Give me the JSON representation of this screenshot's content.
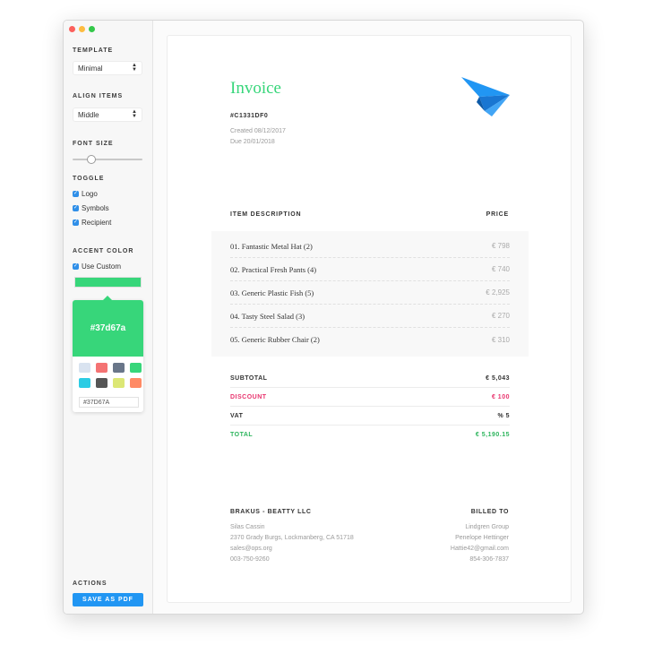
{
  "sidebar": {
    "template_label": "TEMPLATE",
    "template_value": "Minimal",
    "align_label": "ALIGN ITEMS",
    "align_value": "Middle",
    "font_size_label": "FONT SIZE",
    "toggle_label": "TOGGLE",
    "toggles": [
      "Logo",
      "Symbols",
      "Recipient"
    ],
    "accent_label": "ACCENT COLOR",
    "use_custom_label": "Use Custom",
    "accent_color": "#37d67a",
    "accent_hex_display": "#37d67a",
    "hex_input_value": "#37D67A",
    "swatches": [
      "#d9e3f0",
      "#f47373",
      "#697689",
      "#37d67a",
      "#2ccce4",
      "#555555",
      "#dce775",
      "#ff8a65"
    ],
    "actions_label": "ACTIONS",
    "save_label": "SAVE AS PDF"
  },
  "invoice": {
    "title": "Invoice",
    "id": "#C1331DF0",
    "created": "Created 08/12/2017",
    "due": "Due 20/01/2018",
    "col_description": "ITEM DESCRIPTION",
    "col_price": "PRICE",
    "items": [
      {
        "name": "01. Fantastic Metal Hat (2)",
        "price": "€ 798"
      },
      {
        "name": "02. Practical Fresh Pants (4)",
        "price": "€ 740"
      },
      {
        "name": "03. Generic Plastic Fish (5)",
        "price": "€ 2,925"
      },
      {
        "name": "04. Tasty Steel Salad (3)",
        "price": "€ 270"
      },
      {
        "name": "05. Generic Rubber Chair (2)",
        "price": "€ 310"
      }
    ],
    "totals": {
      "subtotal_label": "SUBTOTAL",
      "subtotal_value": "€ 5,043",
      "discount_label": "DISCOUNT",
      "discount_value": "€ 100",
      "vat_label": "VAT",
      "vat_value": "% 5",
      "total_label": "TOTAL",
      "total_value": "€ 5,190.15"
    },
    "colors": {
      "discount": "#e8336d",
      "total": "#2db55d"
    },
    "sender": {
      "name": "BRAKUS - BEATTY LLC",
      "contact": "Silas Cassin",
      "address": "2370 Grady Burgs, Lockmanberg, CA 51718",
      "email": "sales@ops.org",
      "phone": "003-750-9260"
    },
    "billed": {
      "label": "BILLED TO",
      "company": "Lindgren Group",
      "contact": "Penelope Hettinger",
      "email": "Hattie42@gmail.com",
      "phone": "854-306-7837"
    }
  }
}
